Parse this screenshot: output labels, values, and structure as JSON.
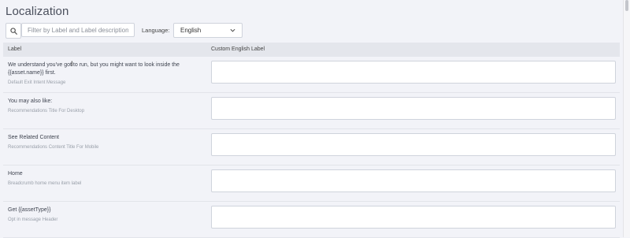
{
  "page": {
    "title": "Localization"
  },
  "toolbar": {
    "search_placeholder": "Filter by Label and Label description",
    "search_value": "",
    "language_label": "Language:",
    "language_selected": "English"
  },
  "table": {
    "columns": {
      "label": "Label",
      "custom": "Custom English Label"
    },
    "rows": [
      {
        "label": "We understand you've got to run, but you might want to look inside the {{asset.name}} first.",
        "description": "Default Exit Intent Message",
        "value": ""
      },
      {
        "label": "You may also like:",
        "description": "Recommendations Title For Desktop",
        "value": ""
      },
      {
        "label": "See Related Content",
        "description": "Recommendations Content Title For Mobile",
        "value": ""
      },
      {
        "label": "Home",
        "description": "Breadcrumb home menu item label",
        "value": ""
      },
      {
        "label": "Get {{assetType}}",
        "description": "Opt in message Header",
        "value": ""
      }
    ]
  }
}
